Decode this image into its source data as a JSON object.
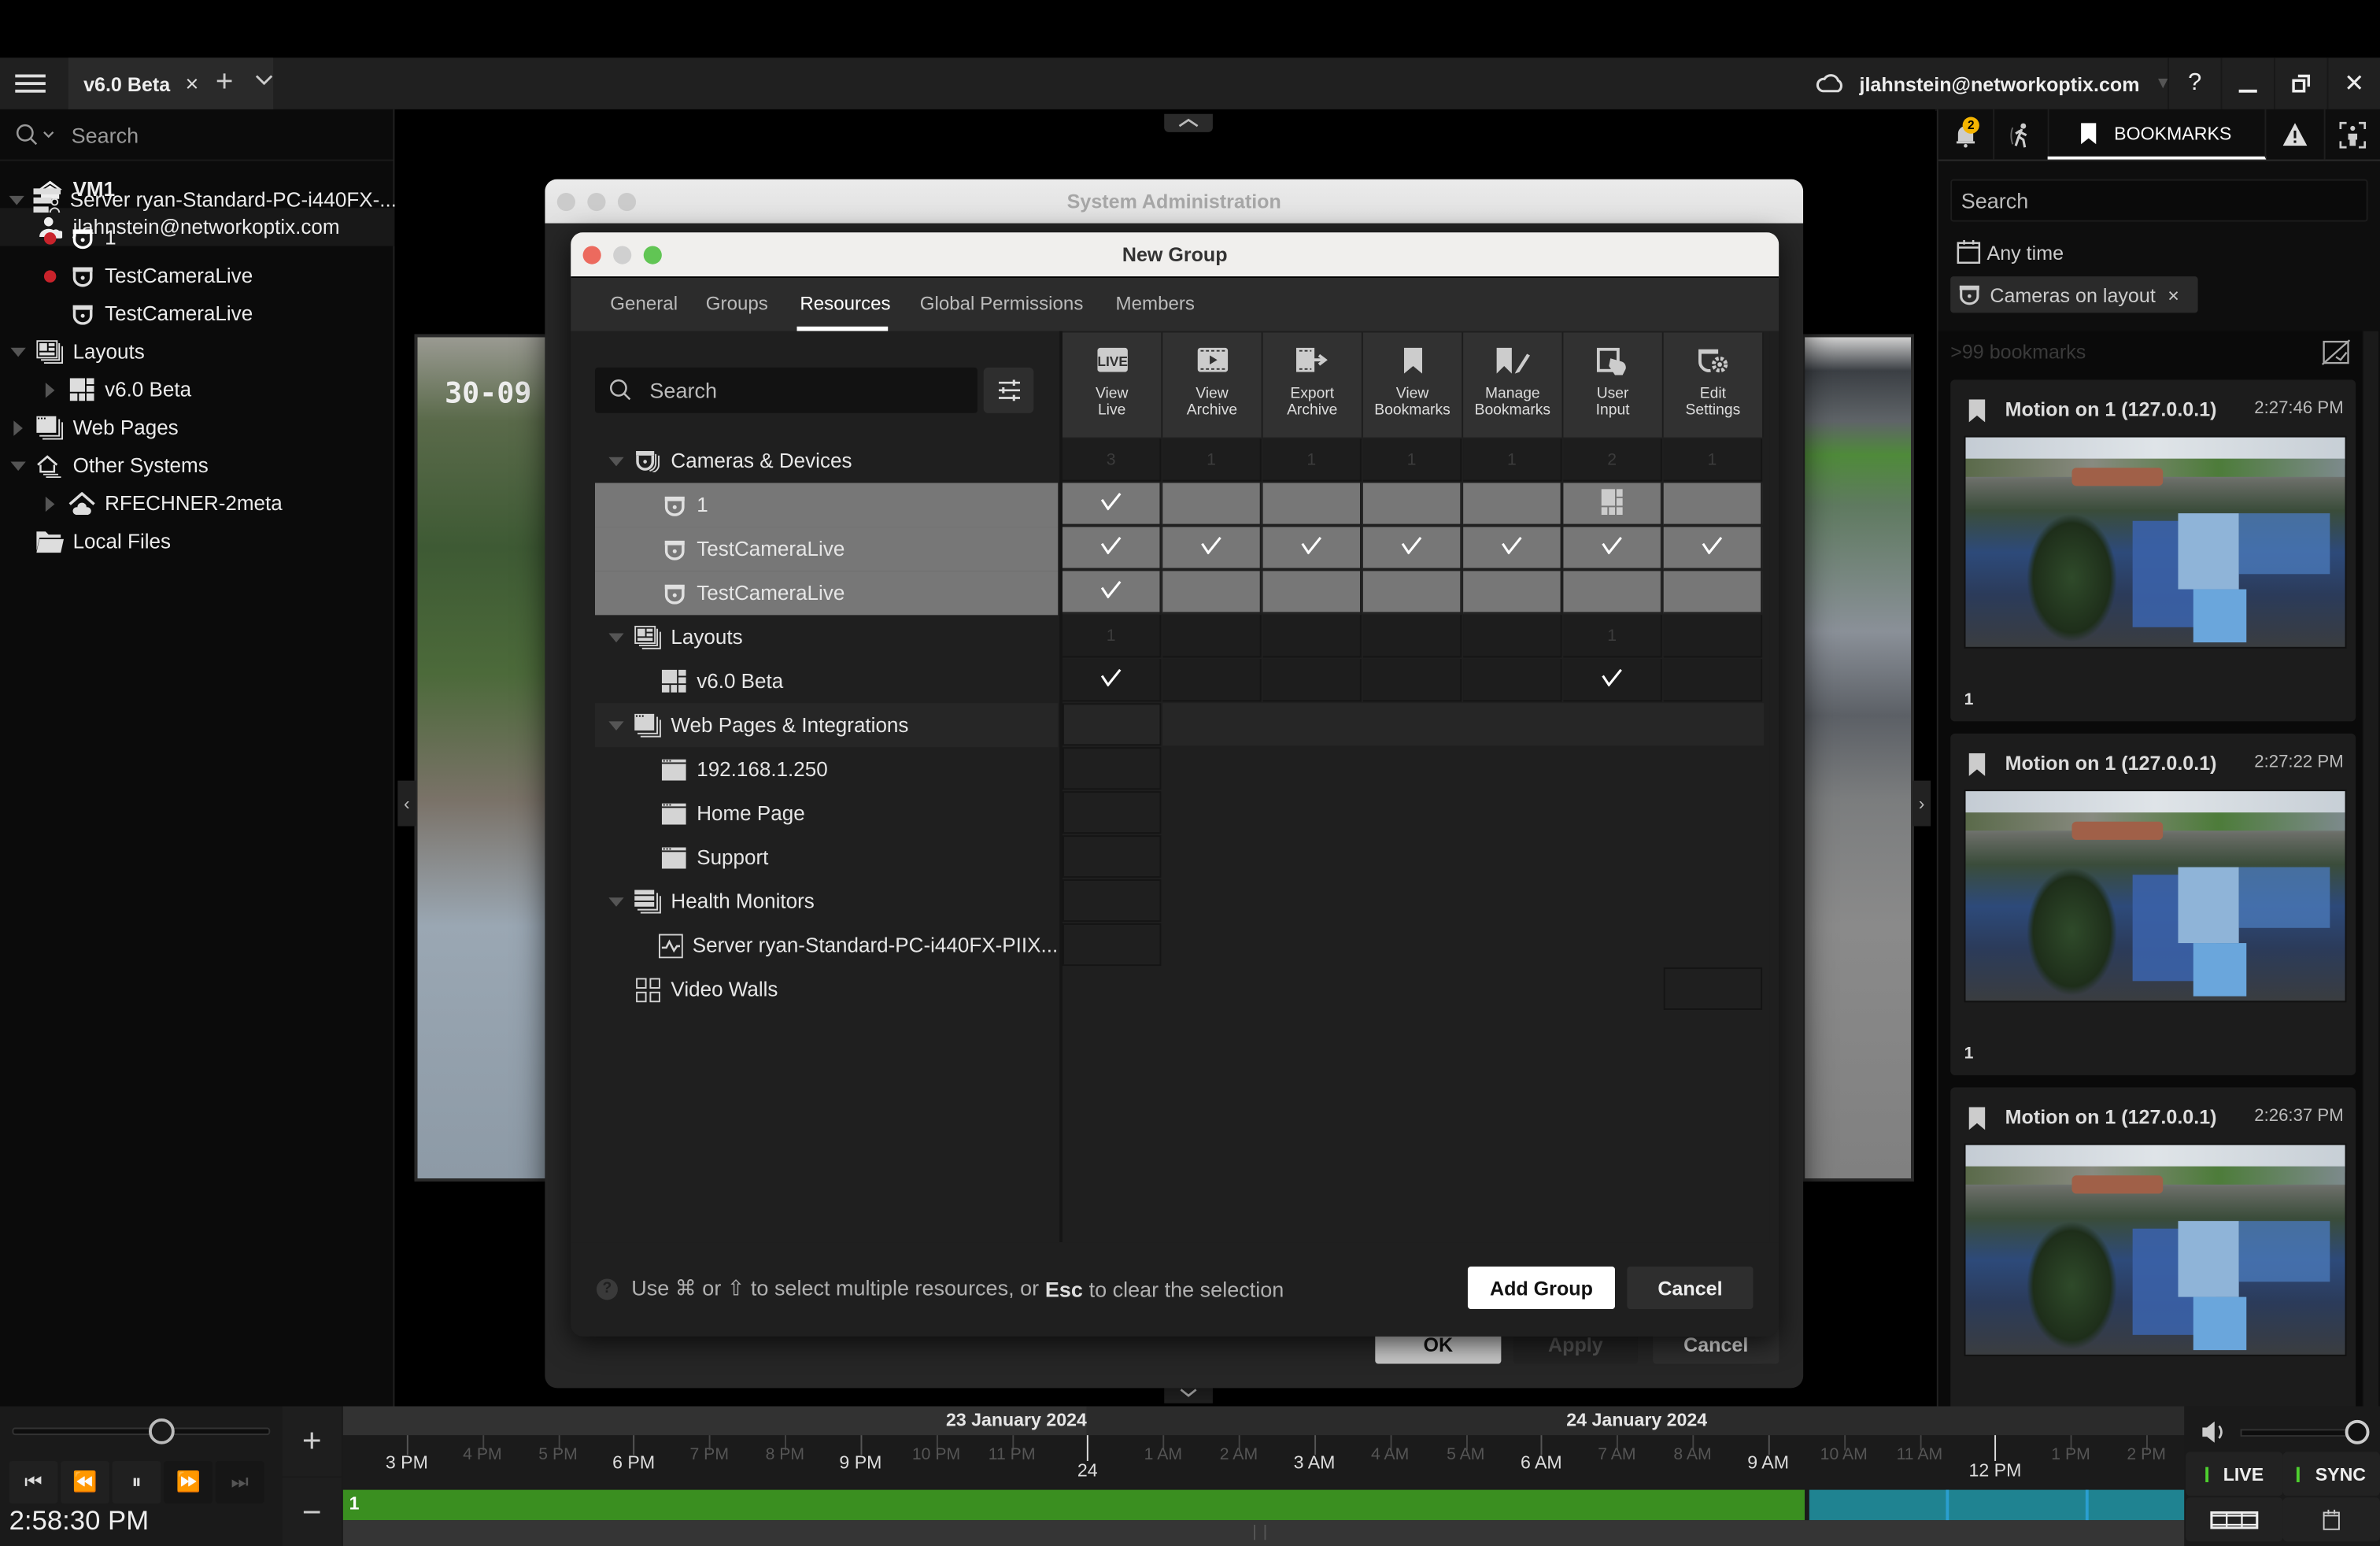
{
  "titlebar": {
    "tab_label": "v6.0 Beta",
    "tab_close": "×",
    "new_tab": "+",
    "tab_menu": "⌄",
    "cloud_user": "jlahnstein@networkoptix.com",
    "help": "?",
    "minimize": "—",
    "restore": "⧉",
    "close": "✕"
  },
  "sidebar": {
    "search_placeholder": "Search",
    "system_name": "VM1",
    "user": "jlahnstein@networkoptix.com",
    "items": [
      {
        "label": "Server ryan-Standard-PC-i440FX-...",
        "level": 0,
        "expand": "open",
        "icon": "server-icon"
      },
      {
        "label": "1",
        "level": 1,
        "recording": true,
        "icon": "camera-icon"
      },
      {
        "label": "TestCameraLive",
        "level": 1,
        "recording": true,
        "icon": "camera-icon"
      },
      {
        "label": "TestCameraLive",
        "level": 1,
        "recording": false,
        "icon": "camera-icon"
      },
      {
        "label": "Layouts",
        "level": 0,
        "expand": "open",
        "icon": "layouts-icon"
      },
      {
        "label": "v6.0 Beta",
        "level": 1,
        "expand": "closed",
        "icon": "layout-icon"
      },
      {
        "label": "Web Pages",
        "level": 0,
        "expand": "closed",
        "icon": "webpages-icon"
      },
      {
        "label": "Other Systems",
        "level": 0,
        "expand": "open",
        "icon": "other-systems-icon"
      },
      {
        "label": "RFECHNER-2meta",
        "level": 1,
        "expand": "closed",
        "icon": "cloud-system-icon"
      },
      {
        "label": "Local Files",
        "level": 0,
        "icon": "folder-icon"
      }
    ]
  },
  "center": {
    "camera_overlay_text": "30-09"
  },
  "right_panel": {
    "notification_count": "2",
    "active_tab": "BOOKMARKS",
    "search_placeholder": "Search",
    "time_filter": "Any time",
    "camera_filter": "Cameras on layout",
    "camera_filter_remove": "×",
    "count_text": ">99 bookmarks",
    "bookmarks": [
      {
        "title": "Motion on 1 (127.0.0.1)",
        "time": "2:27:46 PM",
        "camera": "1"
      },
      {
        "title": "Motion on 1 (127.0.0.1)",
        "time": "2:27:22 PM",
        "camera": "1"
      },
      {
        "title": "Motion on 1 (127.0.0.1)",
        "time": "2:26:37 PM",
        "camera": "1"
      }
    ]
  },
  "system_admin": {
    "title": "System Administration",
    "ok": "OK",
    "apply": "Apply",
    "cancel": "Cancel"
  },
  "new_group": {
    "title": "New Group",
    "tabs": [
      "General",
      "Groups",
      "Resources",
      "Global Permissions",
      "Members"
    ],
    "active_tab": "Resources",
    "search_placeholder": "Search",
    "columns": [
      {
        "line1": "View",
        "line2": "Live",
        "icon": "live-icon",
        "count": "3"
      },
      {
        "line1": "View",
        "line2": "Archive",
        "icon": "archive-icon",
        "count": "1"
      },
      {
        "line1": "Export",
        "line2": "Archive",
        "icon": "export-icon",
        "count": "1"
      },
      {
        "line1": "View",
        "line2": "Bookmarks",
        "icon": "bookmark-icon",
        "count": "1"
      },
      {
        "line1": "Manage",
        "line2": "Bookmarks",
        "icon": "manage-bookmarks-icon",
        "count": "1"
      },
      {
        "line1": "User",
        "line2": "Input",
        "icon": "user-input-icon",
        "count": "2"
      },
      {
        "line1": "Edit",
        "line2": "Settings",
        "icon": "edit-settings-icon",
        "count": "1"
      }
    ],
    "resources": [
      {
        "label": "Cameras & Devices",
        "type": "group",
        "icon": "cameras-group-icon",
        "counts": [
          "3",
          "1",
          "1",
          "1",
          "1",
          "2",
          "1"
        ]
      },
      {
        "label": "1",
        "type": "item",
        "icon": "camera-icon",
        "selected": true,
        "perms": [
          "check",
          "",
          "",
          "",
          "",
          "partial",
          ""
        ]
      },
      {
        "label": "TestCameraLive",
        "type": "item",
        "icon": "camera-icon",
        "selected": true,
        "perms": [
          "check",
          "check",
          "check",
          "check",
          "check",
          "check",
          "check"
        ]
      },
      {
        "label": "TestCameraLive",
        "type": "item",
        "icon": "camera-icon",
        "selected": true,
        "perms": [
          "check",
          "",
          "",
          "",
          "",
          "",
          ""
        ]
      },
      {
        "label": "Layouts",
        "type": "group",
        "icon": "layouts-icon",
        "counts": [
          "1",
          "",
          "",
          "",
          "",
          "1",
          ""
        ]
      },
      {
        "label": "v6.0 Beta",
        "type": "item",
        "icon": "layout-icon",
        "perms": [
          "check",
          "",
          "",
          "",
          "",
          "check",
          ""
        ]
      },
      {
        "label": "Web Pages & Integrations",
        "type": "group",
        "icon": "webpages-icon"
      },
      {
        "label": "192.168.1.250",
        "type": "item",
        "icon": "webpage-icon"
      },
      {
        "label": "Home Page",
        "type": "item",
        "icon": "webpage-icon"
      },
      {
        "label": "Support",
        "type": "item",
        "icon": "webpage-icon"
      },
      {
        "label": "Health Monitors",
        "type": "group",
        "icon": "health-monitors-icon"
      },
      {
        "label": "Server ryan-Standard-PC-i440FX-PIIX...",
        "type": "item",
        "icon": "health-monitor-icon"
      },
      {
        "label": "Video Walls",
        "type": "group-noexpand",
        "icon": "videowall-icon"
      }
    ],
    "hint_pre": "Use ⌘ or ⇧ to select multiple resources, or",
    "hint_key": "Esc",
    "hint_post": "to clear the selection",
    "add_button": "Add Group",
    "cancel_button": "Cancel"
  },
  "timeline": {
    "current_time": "2:58:30 PM",
    "zoom_in": "+",
    "zoom_out": "−",
    "dates": [
      "23 January 2024",
      "24 January 2024"
    ],
    "major_labels": [
      "3 PM",
      "6 PM",
      "9 PM",
      "24",
      "3 AM",
      "6 AM",
      "9 AM",
      "12 PM"
    ],
    "minor_labels": [
      "4 PM",
      "5 PM",
      "7 PM",
      "8 PM",
      "10 PM",
      "11 PM",
      "1 AM",
      "2 AM",
      "4 AM",
      "5 AM",
      "7 AM",
      "8 AM",
      "10 AM",
      "11 AM",
      "1 PM",
      "2 PM"
    ],
    "track_label": "1",
    "live": "LIVE",
    "sync": "SYNC",
    "colors": {
      "recording": "#3a8f20",
      "motion": "#1f8391"
    }
  }
}
